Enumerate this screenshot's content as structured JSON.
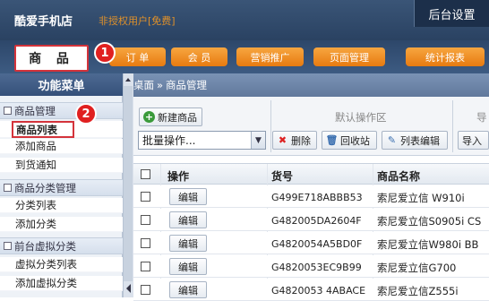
{
  "header": {
    "shop_name": "酷爱手机店",
    "unauth_notice": "非授权用户[免费]",
    "admin_settings": "后台设置"
  },
  "nav": {
    "active_tab": "商 品",
    "tabs": [
      "订 单",
      "会 员",
      "营销推广",
      "页面管理",
      "统计报表"
    ],
    "badge_1": "1"
  },
  "sidebar": {
    "title": "功能菜单",
    "badge_2": "2",
    "sections": [
      {
        "label": "商品管理",
        "items": [
          "商品列表",
          "添加商品",
          "到货通知"
        ]
      },
      {
        "label": "商品分类管理",
        "items": [
          "分类列表",
          "添加分类"
        ]
      },
      {
        "label": "前台虚拟分类",
        "items": [
          "虚拟分类列表",
          "添加虚拟分类"
        ]
      }
    ]
  },
  "breadcrumb": {
    "home": "桌面",
    "sep": "»",
    "current": "商品管理"
  },
  "toolbar": {
    "add_goods": "新建商品",
    "default_ops": "默认操作区",
    "import_partial": "导",
    "batch_select": "批量操作...",
    "delete": "删除",
    "recycle": "回收站",
    "list_edit": "列表编辑",
    "import": "导入"
  },
  "table": {
    "headers": {
      "op": "操作",
      "sku": "货号",
      "name": "商品名称"
    },
    "edit_label": "编辑",
    "rows": [
      {
        "sku": "G499E718ABBB53",
        "name": "索尼爱立信 W910i"
      },
      {
        "sku": "G482005DA2604F",
        "name": "索尼爱立信S0905i CS"
      },
      {
        "sku": "G4820054A5BD0F",
        "name": "索尼爱立信W980i BB"
      },
      {
        "sku": "G4820053EC9B99",
        "name": "索尼爱立信G700"
      },
      {
        "sku": "G4820053 4ABACE",
        "name": "索尼爱立信Z555i"
      }
    ]
  },
  "colors": {
    "accent_orange": "#f08a1c",
    "badge_red": "#e02020",
    "header_blue": "#2e4a6e"
  }
}
